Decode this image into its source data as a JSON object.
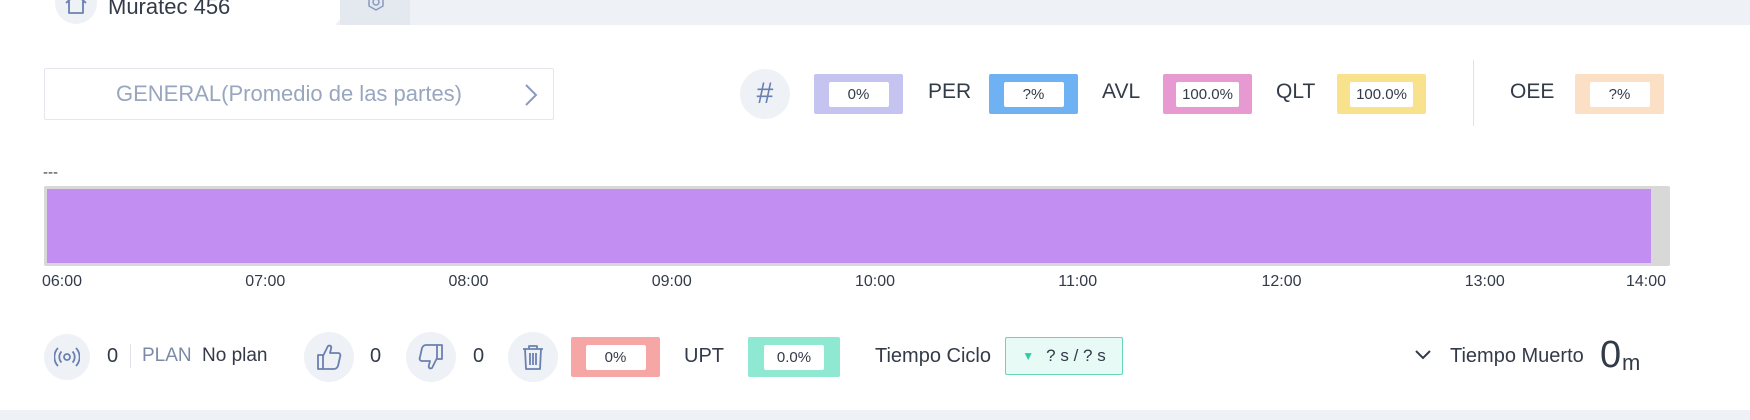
{
  "tab": {
    "title": "Muratec 456",
    "home_icon": "home-icon",
    "second_icon": "settings-hex-icon"
  },
  "selector": {
    "label": "GENERAL(Promedio de las partes)"
  },
  "metrics": {
    "count": {
      "icon": "#",
      "value": "0%",
      "color": "#c5c3f0"
    },
    "per": {
      "label": "PER",
      "value": "?%",
      "color": "#6fb2f4"
    },
    "avl": {
      "label": "AVL",
      "value": "100.0%",
      "color": "#e79ad2"
    },
    "qlt": {
      "label": "QLT",
      "value": "100.0%",
      "color": "#f8e28e"
    },
    "oee": {
      "label": "OEE",
      "value": "?%",
      "color": "#fce0c6"
    }
  },
  "timeline": {
    "header": "---",
    "bar_color": "#c38ef2",
    "ticks": [
      "06:00",
      "07:00",
      "08:00",
      "09:00",
      "10:00",
      "11:00",
      "12:00",
      "13:00",
      "14:00"
    ]
  },
  "bottom": {
    "signal_count": "0",
    "plan_label": "PLAN",
    "plan_value": "No plan",
    "good_count": "0",
    "bad_count": "0",
    "scrap_value": "0%",
    "scrap_color": "#f7a6a6",
    "upt_label": "UPT",
    "upt_value": "0.0%",
    "upt_color": "#8ee8d2",
    "cycle_label": "Tiempo Ciclo",
    "cycle_value": "? s / ? s",
    "dead_label": "Tiempo Muerto",
    "dead_value": "0",
    "dead_unit": "m"
  }
}
